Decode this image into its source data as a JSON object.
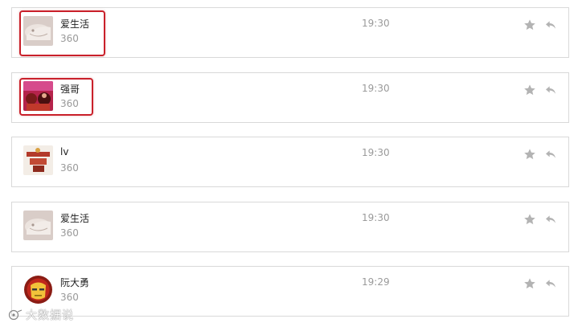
{
  "messages": [
    {
      "name": "爱生活",
      "sub": "360",
      "time": "19:30",
      "avatar": "cake-photo",
      "highlighted": true
    },
    {
      "name": "强哥",
      "sub": "360",
      "time": "19:30",
      "avatar": "red-party-photo",
      "highlighted": true
    },
    {
      "name": "lv",
      "sub": "360",
      "time": "19:30",
      "avatar": "chinese-dragon-photo",
      "highlighted": false
    },
    {
      "name": "爱生活",
      "sub": "360",
      "time": "19:30",
      "avatar": "cake-photo",
      "highlighted": false
    },
    {
      "name": "阮大勇",
      "sub": "360",
      "time": "19:29",
      "avatar": "iron-man-icon",
      "highlighted": false
    }
  ],
  "icons": {
    "star": "star-icon",
    "reply": "reply-icon"
  },
  "colors": {
    "highlight": "#c9202a",
    "icon": "#b3b3b3",
    "border": "#d9d9d9"
  },
  "watermark": "大数据说"
}
